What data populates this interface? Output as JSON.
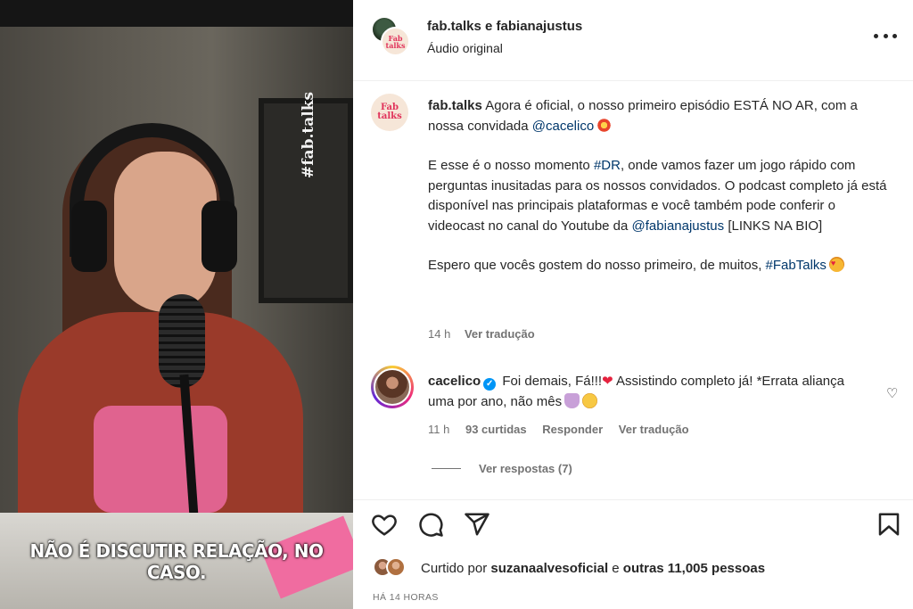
{
  "media": {
    "hashtag_overlay": "#fab.talks",
    "subtitle": "NÃO É DISCUTIR RELAÇÃO, NO CASO."
  },
  "header": {
    "users": "fab.talks e fabianajustus",
    "audio": "Áudio original",
    "brand_mark_line1": "Fab",
    "brand_mark_line2": "talks"
  },
  "caption": {
    "username": "fab.talks",
    "line1": "Agora é oficial, o nosso primeiro episódio ESTÁ NO AR, com a nossa convidada",
    "mention1": "@cacelico",
    "p2_start": "E esse é o nosso momento",
    "hashtag_dr": "#DR",
    "p2_rest": ", onde vamos fazer um jogo rápido com perguntas inusitadas para os nossos convidados. O podcast completo já está disponível nas principais plataformas e você também pode conferir o videocast no canal do Youtube da",
    "mention2": "@fabianajustus",
    "p2_end": "[LINKS NA BIO]",
    "p3": "Espero que vocês gostem do nosso primeiro, de muitos,",
    "hashtag_fab": "#FabTalks",
    "time": "14 h",
    "see_translation": "Ver tradução"
  },
  "comment": {
    "username": "cacelico",
    "text1": "Foi demais, Fá!!!",
    "text2": "Assistindo completo já! *Errata aliança uma por ano, não mês",
    "time": "11 h",
    "likes": "93 curtidas",
    "reply": "Responder",
    "see_translation": "Ver tradução",
    "view_replies": "Ver respostas (7)"
  },
  "likes": {
    "prefix": "Curtido por",
    "user": "suzanaalvesoficial",
    "middle": "e",
    "others": "outras 11,005 pessoas"
  },
  "posted": "HÁ 14 HORAS",
  "icons": [
    "heart-icon",
    "comment-icon",
    "share-icon",
    "bookmark-icon",
    "more-icon",
    "verified-icon"
  ],
  "colors": {
    "link": "#00376b",
    "muted": "#737373",
    "text": "#262626",
    "verified": "#0095f6"
  }
}
